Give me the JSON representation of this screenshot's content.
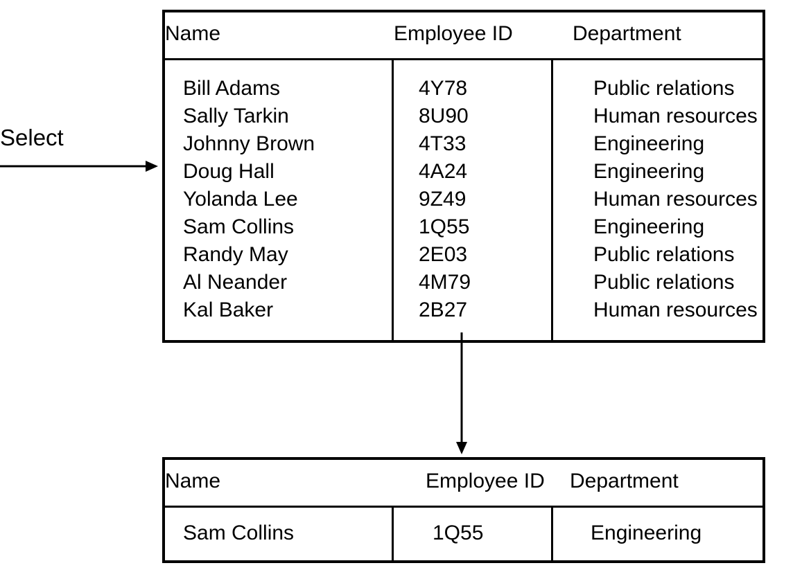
{
  "label_select": "Select",
  "top_table": {
    "headers": {
      "name": "Name",
      "id": "Employee ID",
      "dept": "Department"
    },
    "rows": [
      {
        "name": "Bill Adams",
        "id": "4Y78",
        "dept": "Public relations"
      },
      {
        "name": "Sally Tarkin",
        "id": "8U90",
        "dept": "Human resources"
      },
      {
        "name": "Johnny Brown",
        "id": "4T33",
        "dept": "Engineering"
      },
      {
        "name": "Doug Hall",
        "id": "4A24",
        "dept": "Engineering"
      },
      {
        "name": "Yolanda Lee",
        "id": "9Z49",
        "dept": "Human resources"
      },
      {
        "name": "Sam Collins",
        "id": "1Q55",
        "dept": "Engineering"
      },
      {
        "name": "Randy May",
        "id": "2E03",
        "dept": "Public relations"
      },
      {
        "name": "Al Neander",
        "id": "4M79",
        "dept": "Public relations"
      },
      {
        "name": "Kal Baker",
        "id": "2B27",
        "dept": "Human resources"
      }
    ]
  },
  "bottom_table": {
    "headers": {
      "name": "Name",
      "id": "Employee ID",
      "dept": "Department"
    },
    "row": {
      "name": "Sam Collins",
      "id": "1Q55",
      "dept": "Engineering"
    }
  },
  "chart_data": {
    "type": "table",
    "diagram": "relational Select operation",
    "source_table": {
      "columns": [
        "Name",
        "Employee ID",
        "Department"
      ],
      "rows": [
        [
          "Bill Adams",
          "4Y78",
          "Public relations"
        ],
        [
          "Sally Tarkin",
          "8U90",
          "Human resources"
        ],
        [
          "Johnny Brown",
          "4T33",
          "Engineering"
        ],
        [
          "Doug Hall",
          "4A24",
          "Engineering"
        ],
        [
          "Yolanda Lee",
          "9Z49",
          "Human resources"
        ],
        [
          "Sam Collins",
          "1Q55",
          "Engineering"
        ],
        [
          "Randy May",
          "2E03",
          "Public relations"
        ],
        [
          "Al Neander",
          "4M79",
          "Public relations"
        ],
        [
          "Kal Baker",
          "2B27",
          "Human resources"
        ]
      ]
    },
    "result_table": {
      "columns": [
        "Name",
        "Employee ID",
        "Department"
      ],
      "rows": [
        [
          "Sam Collins",
          "1Q55",
          "Engineering"
        ]
      ]
    }
  }
}
